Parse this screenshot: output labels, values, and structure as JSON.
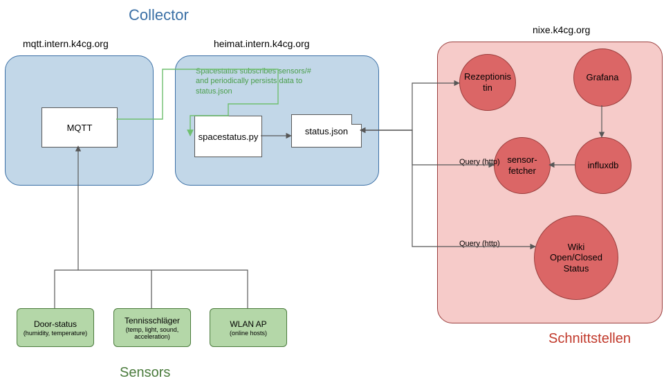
{
  "titles": {
    "collector": "Collector",
    "sensors": "Sensors",
    "schnittstellen": "Schnittstellen"
  },
  "hosts": {
    "mqtt": "mqtt.intern.k4cg.org",
    "heimat": "heimat.intern.k4cg.org",
    "nixe": "nixe.k4cg.org"
  },
  "nodes": {
    "mqtt": "MQTT",
    "spacestatus": "spacestatus.py",
    "statusjson": "status.json",
    "rezeptionistin": "Rezeptionistin",
    "grafana": "Grafana",
    "sensorfetcher": "sensor-fetcher",
    "influxdb": "influxdb",
    "wiki": "Wiki Open/Closed Status"
  },
  "sensors": {
    "door": {
      "name": "Door-status",
      "sub": "(humidity, temperature)"
    },
    "tennis": {
      "name": "Tennisschläger",
      "sub": "(temp, light, sound, acceleration)"
    },
    "wlan": {
      "name": "WLAN AP",
      "sub": "(online hosts)"
    }
  },
  "note": "Spacestatus subscribes sensors/# and periodically persists data to status.json",
  "edgeLabels": {
    "query1": "Query (http)",
    "query2": "Query (http)"
  }
}
